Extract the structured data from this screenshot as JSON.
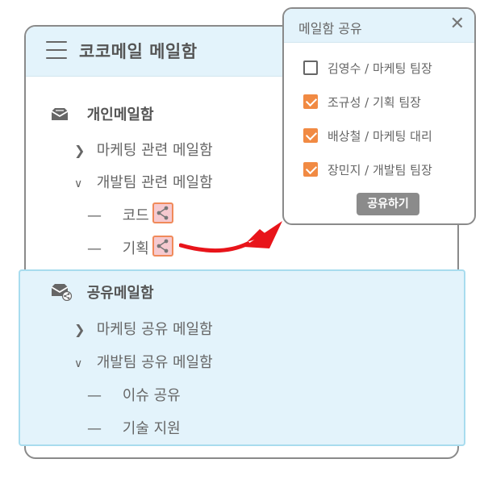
{
  "app": {
    "title": "코코메일 메일함"
  },
  "personal": {
    "title": "개인메일함",
    "folders": [
      {
        "label": "마케팅 관련 메일함",
        "state": "collapsed"
      },
      {
        "label": "개발팀 관련 메일함",
        "state": "expanded"
      }
    ],
    "subfolders": [
      {
        "label": "코드"
      },
      {
        "label": "기획"
      }
    ]
  },
  "shared": {
    "title": "공유메일함",
    "folders": [
      {
        "label": "마케팅 공유 메일함",
        "state": "collapsed"
      },
      {
        "label": "개발팀 공유 메일함",
        "state": "expanded"
      }
    ],
    "subfolders": [
      {
        "label": "이슈 공유"
      },
      {
        "label": "기술 지원"
      }
    ]
  },
  "share_dialog": {
    "title": "메일함 공유",
    "members": [
      {
        "label": "김영수 / 마케팅 팀장",
        "checked": false
      },
      {
        "label": "조규성 / 기획 팀장",
        "checked": true
      },
      {
        "label": "배상철 / 마케팅 대리",
        "checked": true
      },
      {
        "label": "장민지 / 개발팀 팀장",
        "checked": true
      }
    ],
    "submit_label": "공유하기"
  },
  "colors": {
    "header_bg": "#e3f3fb",
    "shared_border": "#a8dcee",
    "checkbox_checked": "#f18a43",
    "share_icon_border": "#f08a5a",
    "arrow": "#e8141a",
    "submit_bg": "#8b8b8b"
  },
  "icons": [
    "hamburger-icon",
    "mail-icon",
    "shared-mail-icon",
    "chevron-right-icon",
    "chevron-down-icon",
    "share-icon",
    "close-icon",
    "check-icon"
  ]
}
